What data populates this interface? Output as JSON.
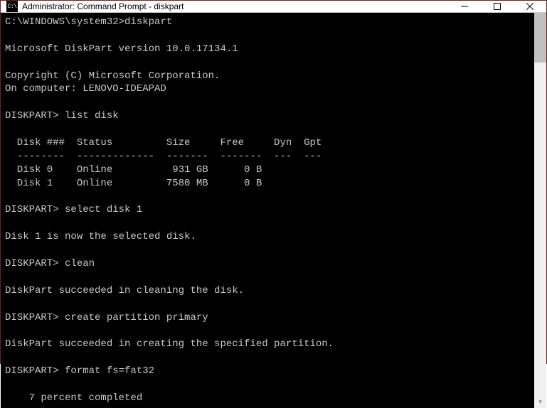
{
  "titlebar": {
    "icon_label": "C:\\",
    "title": "Administrator: Command Prompt - diskpart",
    "min": "Minimize",
    "max": "Maximize",
    "close": "Close"
  },
  "terminal": {
    "line1_prompt": "C:\\WINDOWS\\system32>",
    "line1_cmd": "diskpart",
    "blank": "",
    "version": "Microsoft DiskPart version 10.0.17134.1",
    "copyright": "Copyright (C) Microsoft Corporation.",
    "on_computer": "On computer: LENOVO-IDEAPAD",
    "p1_prompt": "DISKPART> ",
    "p1_cmd": "list disk",
    "table_header": "  Disk ###  Status         Size     Free     Dyn  Gpt",
    "table_sep": "  --------  -------------  -------  -------  ---  ---",
    "table_row0": "  Disk 0    Online          931 GB      0 B",
    "table_row1": "  Disk 1    Online         7580 MB      0 B",
    "p2_prompt": "DISKPART> ",
    "p2_cmd": "select disk 1",
    "selected_msg": "Disk 1 is now the selected disk.",
    "p3_prompt": "DISKPART> ",
    "p3_cmd": "clean",
    "clean_msg": "DiskPart succeeded in cleaning the disk.",
    "p4_prompt": "DISKPART> ",
    "p4_cmd": "create partition primary",
    "create_msg": "DiskPart succeeded in creating the specified partition.",
    "p5_prompt": "DISKPART> ",
    "p5_cmd": "format fs=fat32",
    "progress": "    7 percent completed"
  }
}
